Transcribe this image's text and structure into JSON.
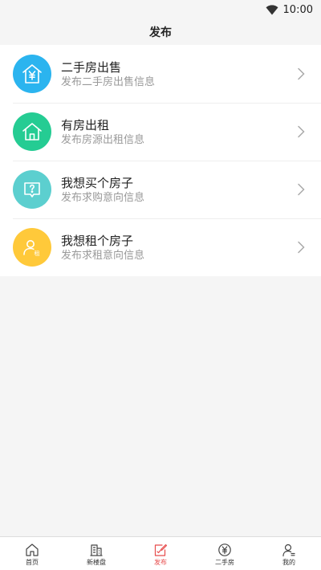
{
  "status_bar": {
    "time": "10:00",
    "wifi_icon": "wifi-icon"
  },
  "header": {
    "title": "发布"
  },
  "menu": [
    {
      "title": "二手房出售",
      "subtitle": "发布二手房出售信息",
      "icon": "house-yen-icon",
      "color": "#2bb4ef"
    },
    {
      "title": "有房出租",
      "subtitle": "发布房源出租信息",
      "icon": "house-icon",
      "color": "#25cc93"
    },
    {
      "title": "我想买个房子",
      "subtitle": "发布求购意向信息",
      "icon": "question-board-icon",
      "color": "#5ccfcf"
    },
    {
      "title": "我想租个房子",
      "subtitle": "发布求租意向信息",
      "icon": "person-rent-icon",
      "color": "#ffc93a",
      "badge": "租"
    }
  ],
  "tabs": [
    {
      "label": "首页",
      "icon": "home-icon",
      "active": false
    },
    {
      "label": "新楼盘",
      "icon": "building-icon",
      "active": false
    },
    {
      "label": "发布",
      "icon": "edit-icon",
      "active": true
    },
    {
      "label": "二手房",
      "icon": "yen-circle-icon",
      "active": false
    },
    {
      "label": "我的",
      "icon": "user-icon",
      "active": false
    }
  ],
  "colors": {
    "active_tab": "#e74c4c",
    "background": "#f5f5f5"
  }
}
